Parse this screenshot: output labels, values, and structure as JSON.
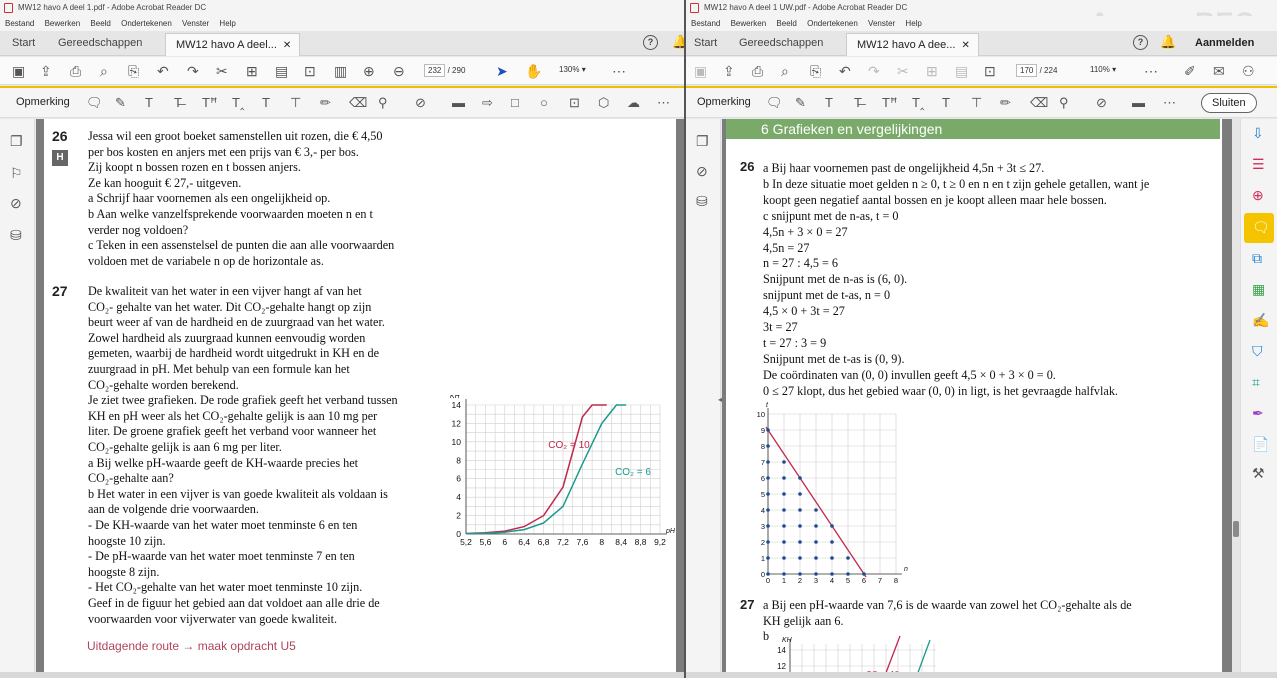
{
  "left": {
    "title": "MW12 havo A deel 1.pdf - Adobe Acrobat Reader DC",
    "menu": [
      "Bestand",
      "Bewerken",
      "Beeld",
      "Ondertekenen",
      "Venster",
      "Help"
    ],
    "tabs": {
      "start": "Start",
      "tools": "Gereedschappen",
      "doc": "MW12 havo A deel..."
    },
    "page_current": "232",
    "page_total": "/ 290",
    "zoom": "130%",
    "anno_label": "Opmerking",
    "doc": {
      "q26_num": "26",
      "badge": "H",
      "q26": [
        "Jessa wil een groot boeket samenstellen uit rozen, die € 4,50",
        "per bos kosten en anjers met een prijs van € 3,- per bos.",
        "Zij koopt n bossen rozen en t bossen anjers.",
        "Ze kan hooguit € 27,- uitgeven.",
        "a   Schrijf haar voornemen als een ongelijkheid op.",
        "b   Aan welke vanzelfsprekende voorwaarden moeten n en t",
        "      verder nog voldoen?",
        "c   Teken in een assenstelsel de punten die aan alle voorwaarden",
        "      voldoen met de variabele n op de horizontale as."
      ],
      "q27_num": "27",
      "q27": [
        "De kwaliteit van het water in een vijver hangt af van het",
        "CO₂- gehalte van het water. Dit CO₂-gehalte hangt op zijn",
        "beurt weer af van de hardheid en de zuurgraad van het water.",
        "Zowel hardheid als zuurgraad kunnen eenvoudig worden",
        "gemeten, waarbij de hardheid wordt uitgedrukt in KH en de",
        "zuurgraad in pH. Met behulp van een formule kan het",
        "CO₂-gehalte worden berekend.",
        "Je ziet twee grafieken. De rode grafiek geeft het verband tussen",
        "KH en pH weer als het CO₂-gehalte gelijk is aan 10 mg per",
        "liter. De groene grafiek geeft het verband voor wanneer het",
        "CO₂-gehalte gelijk is aan 6 mg per liter.",
        "a   Bij welke pH-waarde geeft de KH-waarde precies het",
        "      CO₂-gehalte aan?",
        "b   Het water in een vijver is van goede kwaliteit als voldaan is",
        "      aan de volgende drie voorwaarden.",
        "      - De KH-waarde van het water moet tenminste 6 en ten",
        "         hoogste 10 zijn.",
        "      - De pH-waarde van het water moet tenminste 7 en ten",
        "         hoogste 8 zijn.",
        "      - Het CO₂-gehalte van het water moet tenminste 10 zijn.",
        "      Geef in de figuur het gebied aan dat voldoet aan alle drie de",
        "      voorwaarden voor vijverwater van goede kwaliteit."
      ],
      "route": "Uitdagende route → maak opdracht U5"
    },
    "chart_data": {
      "type": "line",
      "ylabel": "KH",
      "xlabel": "pH",
      "xlim": [
        5.2,
        9.2
      ],
      "ylim": [
        0,
        14
      ],
      "xticks": [
        "5,2",
        "5,6",
        "6",
        "6,4",
        "6,8",
        "7,2",
        "7,6",
        "8",
        "8,4",
        "8,8",
        "9,2"
      ],
      "yticks": [
        "0",
        "2",
        "4",
        "6",
        "8",
        "10",
        "12",
        "14"
      ],
      "series": [
        {
          "name": "CO₂ = 10",
          "color": "#c0284d",
          "x": [
            5.2,
            5.6,
            6.0,
            6.4,
            6.8,
            7.2,
            7.6,
            7.8,
            8.0,
            8.1
          ],
          "y": [
            0.05,
            0.13,
            0.32,
            0.8,
            2.0,
            5.1,
            12.7,
            14,
            14,
            14
          ]
        },
        {
          "name": "CO₂ = 6",
          "color": "#1a9a8c",
          "x": [
            5.2,
            5.6,
            6.0,
            6.4,
            6.8,
            7.2,
            7.6,
            8.0,
            8.3,
            8.5
          ],
          "y": [
            0.03,
            0.08,
            0.19,
            0.48,
            1.2,
            3.0,
            7.6,
            12.0,
            14,
            14
          ]
        }
      ]
    }
  },
  "right": {
    "title": "MW12 havo A deel 1 UW.pdf - Adobe Acrobat Reader DC",
    "menu": [
      "Bestand",
      "Bewerken",
      "Beeld",
      "Ondertekenen",
      "Venster",
      "Help"
    ],
    "tabs": {
      "start": "Start",
      "tools": "Gereedschappen",
      "doc": "MW12 havo A dee...",
      "signin": "Aanmelden"
    },
    "page_current": "170",
    "page_total": "/ 224",
    "zoom": "110%",
    "anno_label": "Opmerking",
    "close_label": "Sluiten",
    "watermark": "ApowerREC",
    "doc": {
      "section": "6  Grafieken en vergelijkingen",
      "q26_num": "26",
      "q26": [
        "a   Bij haar voornemen past de ongelijkheid 4,5n + 3t ≤ 27.",
        "b   In deze situatie moet gelden n ≥ 0, t ≥ 0 en n en t zijn gehele getallen, want je",
        "      koopt geen negatief aantal bossen en je koopt alleen maar hele bossen.",
        "c   snijpunt met de n-as, t = 0",
        "      4,5n + 3 × 0 = 27",
        "      4,5n = 27",
        "      n = 27 : 4,5 = 6",
        "      Snijpunt met de n-as is (6, 0).",
        "      snijpunt met de t-as, n = 0",
        "      4,5 × 0 + 3t = 27",
        "      3t = 27",
        "      t = 27 : 3 = 9",
        "      Snijpunt met de t-as is (0, 9).",
        "      De coördinaten van (0, 0) invullen geeft 4,5 × 0 + 3 × 0 = 0.",
        "      0 ≤ 27 klopt, dus het gebied waar (0, 0) in ligt, is het gevraagde halfvlak."
      ],
      "q27_num": "27",
      "q27": [
        "a   Bij een pH-waarde van 7,6 is de waarde van zowel het CO₂-gehalte als de",
        "      KH gelijk aan 6.",
        "b"
      ]
    },
    "chart_data": {
      "type": "scatter",
      "xlabel": "n",
      "ylabel": "t",
      "xlim": [
        0,
        8
      ],
      "ylim": [
        0,
        10
      ],
      "xticks": [
        "0",
        "1",
        "2",
        "3",
        "4",
        "5",
        "6",
        "7",
        "8"
      ],
      "yticks": [
        "0",
        "1",
        "2",
        "3",
        "4",
        "5",
        "6",
        "7",
        "8",
        "9",
        "10"
      ],
      "boundary": {
        "from": [
          0,
          9
        ],
        "to": [
          6,
          0
        ],
        "color": "#c0284d"
      },
      "points": [
        [
          0,
          0
        ],
        [
          0,
          1
        ],
        [
          0,
          2
        ],
        [
          0,
          3
        ],
        [
          0,
          4
        ],
        [
          0,
          5
        ],
        [
          0,
          6
        ],
        [
          0,
          7
        ],
        [
          0,
          8
        ],
        [
          0,
          9
        ],
        [
          1,
          0
        ],
        [
          1,
          1
        ],
        [
          1,
          2
        ],
        [
          1,
          3
        ],
        [
          1,
          4
        ],
        [
          1,
          5
        ],
        [
          1,
          6
        ],
        [
          1,
          7
        ],
        [
          2,
          0
        ],
        [
          2,
          1
        ],
        [
          2,
          2
        ],
        [
          2,
          3
        ],
        [
          2,
          4
        ],
        [
          2,
          5
        ],
        [
          2,
          6
        ],
        [
          3,
          0
        ],
        [
          3,
          1
        ],
        [
          3,
          2
        ],
        [
          3,
          3
        ],
        [
          3,
          4
        ],
        [
          4,
          0
        ],
        [
          4,
          1
        ],
        [
          4,
          2
        ],
        [
          4,
          3
        ],
        [
          5,
          0
        ],
        [
          5,
          1
        ],
        [
          6,
          0
        ]
      ]
    },
    "chart2": {
      "ylabel": "KH",
      "yticks": [
        "14",
        "12"
      ],
      "label": "CO₂ = 10"
    }
  }
}
